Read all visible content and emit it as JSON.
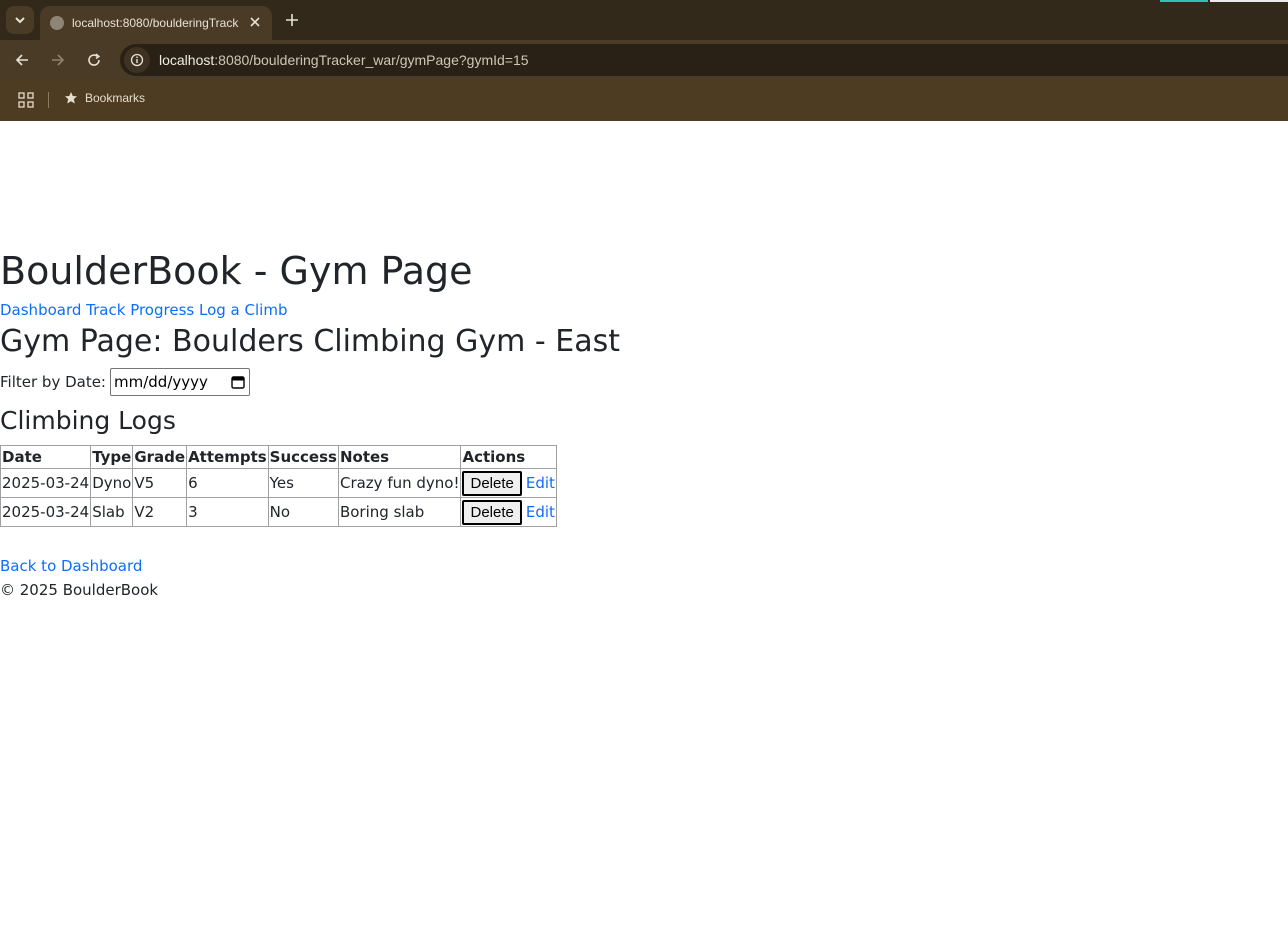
{
  "browser": {
    "tab_title": "localhost:8080/boulderingTrack",
    "url_host": "localhost",
    "url_rest": ":8080/boulderingTracker_war/gymPage?gymId=15",
    "bookmarks_label": "Bookmarks"
  },
  "page": {
    "site_title": "BoulderBook - Gym Page",
    "nav": [
      {
        "label": "Dashboard"
      },
      {
        "label": "Track Progress"
      },
      {
        "label": "Log a Climb"
      }
    ],
    "gym_title": "Gym Page: Boulders Climbing Gym - East",
    "filter_label": "Filter by Date:",
    "date_placeholder": "mm/dd/yyyy",
    "logs_title": "Climbing Logs",
    "table": {
      "headers": [
        "Date",
        "Type",
        "Grade",
        "Attempts",
        "Success",
        "Notes",
        "Actions"
      ],
      "rows": [
        {
          "date": "2025-03-24",
          "type": "Dyno",
          "grade": "V5",
          "attempts": "6",
          "success": "Yes",
          "notes": "Crazy fun dyno!",
          "delete": "Delete",
          "edit": "Edit"
        },
        {
          "date": "2025-03-24",
          "type": "Slab",
          "grade": "V2",
          "attempts": "3",
          "success": "No",
          "notes": "Boring slab",
          "delete": "Delete",
          "edit": "Edit"
        }
      ]
    },
    "back_link": "Back to Dashboard",
    "footer": "© 2025 BoulderBook"
  }
}
